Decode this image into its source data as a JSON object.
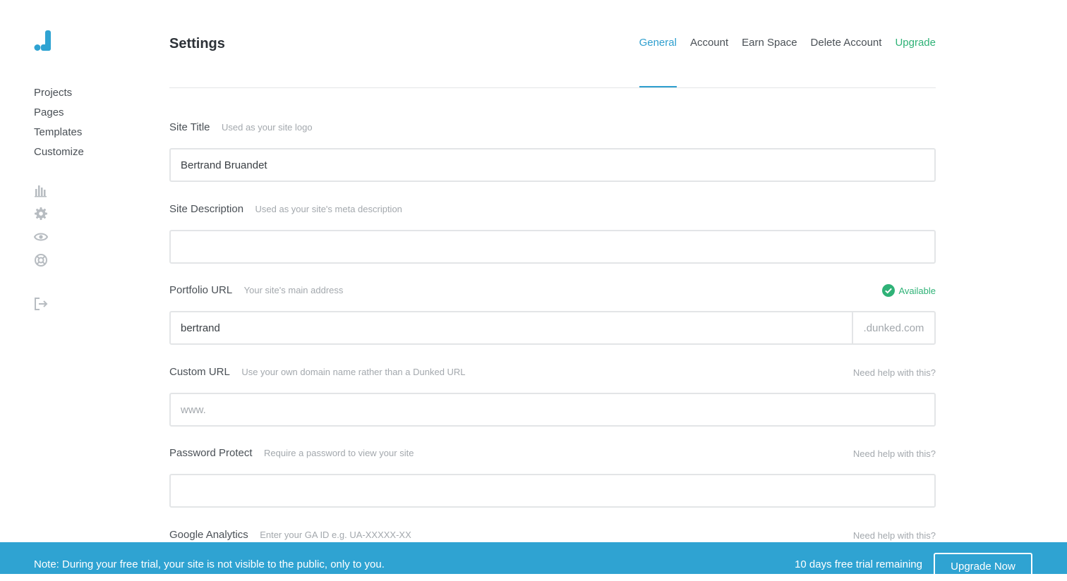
{
  "app": {
    "logo_icon": "dunked-logo",
    "brand_color": "#2fa3d2"
  },
  "sidebar": {
    "items": [
      {
        "label": "Projects"
      },
      {
        "label": "Pages"
      },
      {
        "label": "Templates"
      },
      {
        "label": "Customize"
      }
    ],
    "icons": [
      "stats-icon",
      "gear-icon",
      "eye-icon",
      "help-lifebuoy-icon"
    ],
    "logout_icon": "logout-icon"
  },
  "header": {
    "title": "Settings",
    "tabs": [
      {
        "label": "General",
        "active": true
      },
      {
        "label": "Account"
      },
      {
        "label": "Earn Space"
      },
      {
        "label": "Delete Account"
      },
      {
        "label": "Upgrade",
        "color": "#2fb277"
      }
    ]
  },
  "form": {
    "site_title": {
      "label": "Site Title",
      "hint": "Used as your site logo",
      "value": "Bertrand Bruandet"
    },
    "site_description": {
      "label": "Site Description",
      "hint": "Used as your site's meta description",
      "value": ""
    },
    "portfolio_url": {
      "label": "Portfolio URL",
      "hint": "Your site's main address",
      "status": "Available",
      "status_color": "#2fb277",
      "value": "bertrand",
      "suffix": ".dunked.com"
    },
    "custom_url": {
      "label": "Custom URL",
      "hint": "Use your own domain name rather than a Dunked URL",
      "help": "Need help with this?",
      "placeholder": "www.",
      "value": ""
    },
    "password_protect": {
      "label": "Password Protect",
      "hint": "Require a password to view your site",
      "help": "Need help with this?",
      "value": ""
    },
    "google_analytics": {
      "label": "Google Analytics",
      "hint": "Enter your GA ID e.g. UA-XXXXX-XX",
      "help": "Need help with this?"
    }
  },
  "footer": {
    "note": "Note: During your free trial, your site is not visible to the public, only to you.",
    "trial_remaining": "10 days free trial remaining",
    "upgrade_button": "Upgrade Now"
  }
}
